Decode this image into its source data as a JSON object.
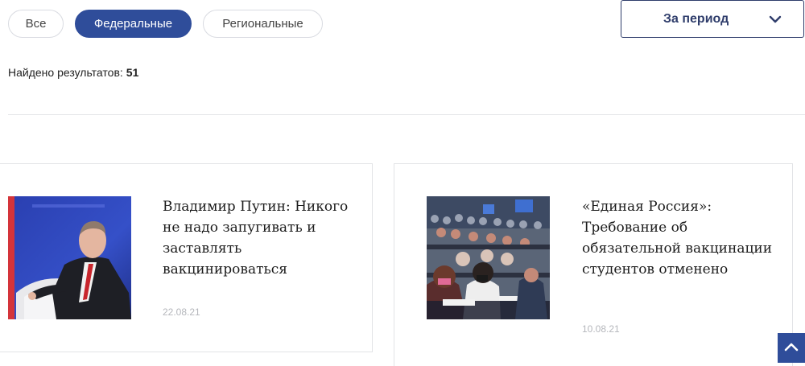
{
  "filters": {
    "all_label": "Все",
    "federal_label": "Федеральные",
    "regional_label": "Региональные"
  },
  "period": {
    "label": "За период",
    "icon": "chevron-down-icon"
  },
  "results": {
    "label": "Найдено результатов:",
    "count": "51"
  },
  "articles": [
    {
      "title": "Владимир Путин: Никого не надо запугивать и заставлять вакцинироваться",
      "date": "22.08.21",
      "image": "photo-putin"
    },
    {
      "title": "«Единая Россия»: Требование об обязательной вакцинации студентов отменено",
      "date": "10.08.21",
      "image": "photo-students-auditorium"
    }
  ],
  "scroll_top": {
    "icon": "chevron-up-icon"
  },
  "colors": {
    "accent": "#2f4d9a",
    "period_border": "#2f3d6b",
    "date_text": "#b5b7bc"
  }
}
